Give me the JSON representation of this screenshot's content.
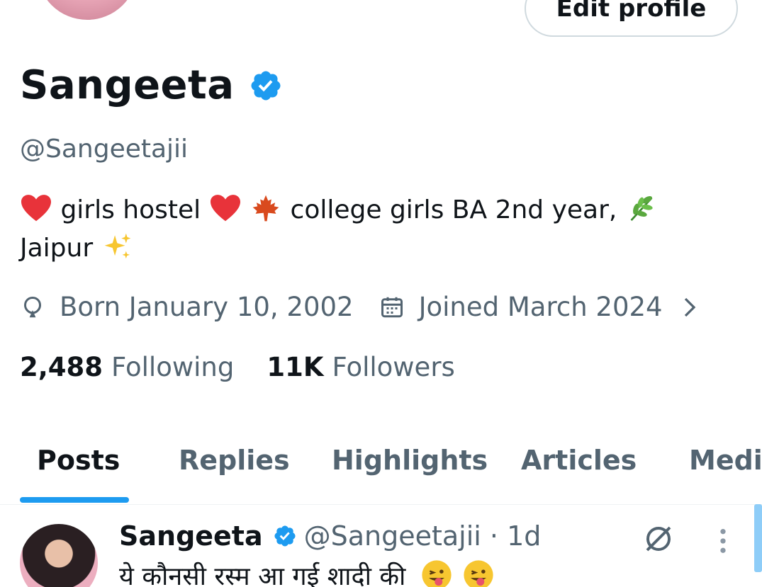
{
  "profile": {
    "edit_label": "Edit profile",
    "name": "Sangeeta",
    "handle": "@Sangeetajii",
    "bio": {
      "part1": "girls hostel",
      "part2": "college girls BA 2nd year,",
      "part3": "Jaipur"
    },
    "born": "Born January 10, 2002",
    "joined": "Joined March 2024",
    "following_count": "2,488",
    "following_label": "Following",
    "followers_count": "11K",
    "followers_label": "Followers"
  },
  "tabs": [
    {
      "label": "Posts"
    },
    {
      "label": "Replies"
    },
    {
      "label": "Highlights"
    },
    {
      "label": "Articles"
    },
    {
      "label": "Media"
    }
  ],
  "tweet": {
    "name": "Sangeeta",
    "handle_time": "@Sangeetajii · 1d",
    "text": "ये कौनसी रस्म आ गई शादी की"
  },
  "icons": {
    "verified": "verified-badge-icon",
    "birthday": "balloon-icon",
    "calendar": "calendar-icon",
    "chevron": "chevron-right-icon",
    "grok": "grok-icon",
    "more": "more-vertical-icon"
  },
  "colors": {
    "accent": "#1d9bf0",
    "secondary_text": "#536471",
    "primary_text": "#0f1419",
    "border": "#cfd9de"
  }
}
